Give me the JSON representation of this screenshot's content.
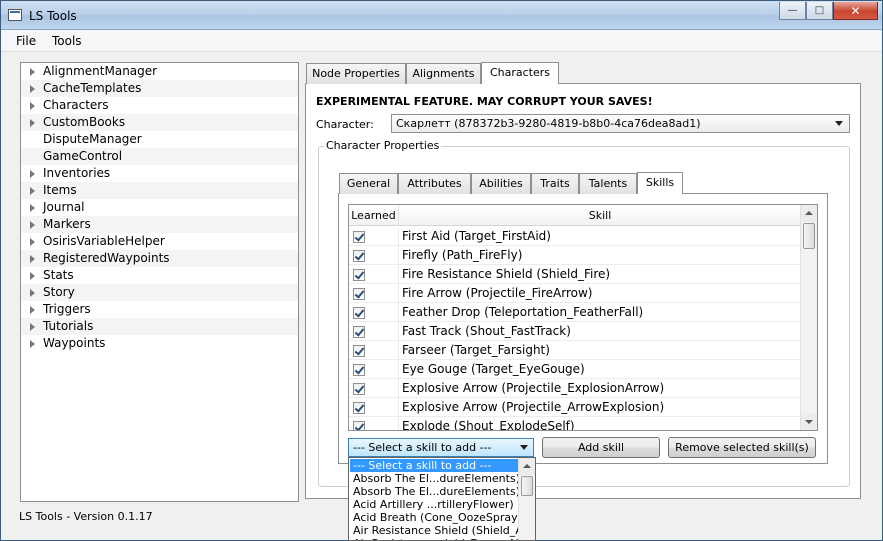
{
  "window": {
    "title": "LS Tools"
  },
  "menu": [
    "File",
    "Tools"
  ],
  "tree": [
    {
      "label": "AlignmentManager",
      "expandable": true
    },
    {
      "label": "CacheTemplates",
      "expandable": true
    },
    {
      "label": "Characters",
      "expandable": true
    },
    {
      "label": "CustomBooks",
      "expandable": true
    },
    {
      "label": "DisputeManager",
      "expandable": false
    },
    {
      "label": "GameControl",
      "expandable": false
    },
    {
      "label": "Inventories",
      "expandable": true
    },
    {
      "label": "Items",
      "expandable": true
    },
    {
      "label": "Journal",
      "expandable": true
    },
    {
      "label": "Markers",
      "expandable": true
    },
    {
      "label": "OsirisVariableHelper",
      "expandable": true
    },
    {
      "label": "RegisteredWaypoints",
      "expandable": true
    },
    {
      "label": "Stats",
      "expandable": true
    },
    {
      "label": "Story",
      "expandable": true
    },
    {
      "label": "Triggers",
      "expandable": true
    },
    {
      "label": "Tutorials",
      "expandable": true
    },
    {
      "label": "Waypoints",
      "expandable": true
    }
  ],
  "status": "LS Tools - Version 0.1.17",
  "main_tabs": [
    "Node Properties",
    "Alignments",
    "Characters"
  ],
  "warning": "EXPERIMENTAL FEATURE.  MAY CORRUPT YOUR SAVES!",
  "character": {
    "label": "Character:",
    "value": "Скарлетт (878372b3-9280-4819-b8b0-4ca76dea8ad1)"
  },
  "group_title": "Character Properties",
  "sub_tabs": [
    "General",
    "Attributes",
    "Abilities",
    "Traits",
    "Talents",
    "Skills"
  ],
  "table": {
    "headers": [
      "Learned",
      "Skill"
    ],
    "rows": [
      "First Aid (Target_FirstAid)",
      "Firefly (Path_FireFly)",
      "Fire Resistance Shield (Shield_Fire)",
      "Fire Arrow (Projectile_FireArrow)",
      "Feather Drop (Teleportation_FeatherFall)",
      "Fast Track (Shout_FastTrack)",
      "Farseer (Target_Farsight)",
      "Eye Gouge (Target_EyeGouge)",
      "Explosive Arrow (Projectile_ExplosionArrow)",
      "Explosive Arrow (Projectile_ArrowExplosion)",
      "Explode (Shout_ExplodeSelf)"
    ]
  },
  "skill_select": {
    "value": "--- Select a skill to add ---"
  },
  "buttons": {
    "add": "Add skill",
    "remove": "Remove selected skill(s)"
  },
  "dropdown": [
    "--- Select a skill to add ---",
    "Absorb The El...dureElements)",
    "Absorb The El...dureElements)",
    "Acid Artillery ...rtilleryFlower)",
    "Acid Breath (Cone_OozeSpray)",
    "Air Resistance Shield (Shield_Air)",
    "Air Resistance ...ield_EnemyAir)"
  ]
}
